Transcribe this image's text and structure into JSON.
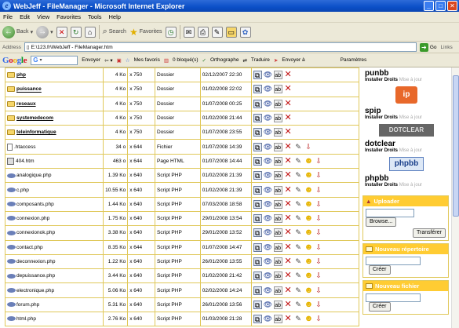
{
  "window": {
    "title": "WebJeff - FileManager - Microsoft Internet Explorer"
  },
  "menu": [
    "File",
    "Edit",
    "View",
    "Favorites",
    "Tools",
    "Help"
  ],
  "toolbar": {
    "back": "Back",
    "search": "Search",
    "favorites": "Favorites"
  },
  "address": {
    "label": "Address",
    "url": "E:\\123.fr\\WebJeff - FileManager.htm",
    "go": "Go",
    "links": "Links"
  },
  "googlebar": {
    "logo": "Google",
    "search_g": "G",
    "envoyer": "Envoyer",
    "favoris": "Mes favoris",
    "bloques": "0 bloqué(s)",
    "ortho": "Orthographe",
    "traduire": "Traduire",
    "envoyer_a": "Envoyer à",
    "parametres": "Paramètres"
  },
  "files": [
    {
      "name": "php",
      "size": "4 Ko",
      "perm": "x 750",
      "type": "Dossier",
      "date": "02/12/2007 22:30",
      "kind": "folder"
    },
    {
      "name": "puissance",
      "size": "4 Ko",
      "perm": "x 750",
      "type": "Dossier",
      "date": "01/02/2008 22:02",
      "kind": "folder"
    },
    {
      "name": "reseaux",
      "size": "4 Ko",
      "perm": "x 750",
      "type": "Dossier",
      "date": "01/07/2008 00:25",
      "kind": "folder"
    },
    {
      "name": "systemedecom",
      "size": "4 Ko",
      "perm": "x 750",
      "type": "Dossier",
      "date": "01/02/2008 21:44",
      "kind": "folder"
    },
    {
      "name": "teleinformatique",
      "size": "4 Ko",
      "perm": "x 750",
      "type": "Dossier",
      "date": "01/07/2008 23:55",
      "kind": "folder"
    },
    {
      "name": ".htaccess",
      "size": "34 o",
      "perm": "x 644",
      "type": "Fichier",
      "date": "01/07/2008 14:39",
      "kind": "file"
    },
    {
      "name": "404.htm",
      "size": "463 o",
      "perm": "x 644",
      "type": "Page HTML",
      "date": "01/07/2008 14:44",
      "kind": "html"
    },
    {
      "name": "analogique.php",
      "size": "1.39 Ko",
      "perm": "x 640",
      "type": "Script PHP",
      "date": "01/02/2008 21:39",
      "kind": "php"
    },
    {
      "name": "c.php",
      "size": "10.55 Ko",
      "perm": "x 640",
      "type": "Script PHP",
      "date": "01/02/2008 21:39",
      "kind": "php"
    },
    {
      "name": "composants.php",
      "size": "1.44 Ko",
      "perm": "x 640",
      "type": "Script PHP",
      "date": "07/03/2008 18:58",
      "kind": "php"
    },
    {
      "name": "connexion.php",
      "size": "1.75 Ko",
      "perm": "x 640",
      "type": "Script PHP",
      "date": "29/01/2008 13:54",
      "kind": "php"
    },
    {
      "name": "connexionok.php",
      "size": "3.38 Ko",
      "perm": "x 640",
      "type": "Script PHP",
      "date": "29/01/2008 13:52",
      "kind": "php"
    },
    {
      "name": "contact.php",
      "size": "8.35 Ko",
      "perm": "x 644",
      "type": "Script PHP",
      "date": "01/07/2008 14:47",
      "kind": "php"
    },
    {
      "name": "deconnexion.php",
      "size": "1.22 Ko",
      "perm": "x 640",
      "type": "Script PHP",
      "date": "26/01/2008 13:55",
      "kind": "php"
    },
    {
      "name": "depuissance.php",
      "size": "3.44 Ko",
      "perm": "x 640",
      "type": "Script PHP",
      "date": "01/02/2008 21:42",
      "kind": "php"
    },
    {
      "name": "electronique.php",
      "size": "5.06 Ko",
      "perm": "x 640",
      "type": "Script PHP",
      "date": "02/02/2008 14:24",
      "kind": "php"
    },
    {
      "name": "forum.php",
      "size": "5.31 Ko",
      "perm": "x 640",
      "type": "Script PHP",
      "date": "26/01/2008 13:56",
      "kind": "php"
    },
    {
      "name": "html.php",
      "size": "2.76 Ko",
      "perm": "x 640",
      "type": "Script PHP",
      "date": "01/03/2008 21:28",
      "kind": "php"
    }
  ],
  "apps": [
    {
      "name": "punbb",
      "installer": "Installer",
      "droits": "Droits",
      "maj": "Mise à jour"
    },
    {
      "name": "spip",
      "installer": "Installer",
      "droits": "Droits",
      "maj": "Mise à jour",
      "logo_text": "ip"
    },
    {
      "name": "dotclear",
      "installer": "Installer",
      "droits": "Droits",
      "maj": "Mise à jour",
      "logo_text": "DOTCLEAR"
    },
    {
      "name": "phpbb",
      "installer": "Installer",
      "droits": "Droits",
      "maj": "Mise à jour",
      "logo_text": "phpbb"
    }
  ],
  "uploader": {
    "title": "Uploader",
    "browse": "Browse...",
    "submit": "Transférer"
  },
  "newdir": {
    "title": "Nouveau répertoire",
    "submit": "Créer"
  },
  "newfile": {
    "title": "Nouveau fichier",
    "submit": "Créer"
  },
  "colors": {
    "accent": "#ffcc33",
    "border": "#e0c85a",
    "titlebar": "#0b4fc7"
  }
}
